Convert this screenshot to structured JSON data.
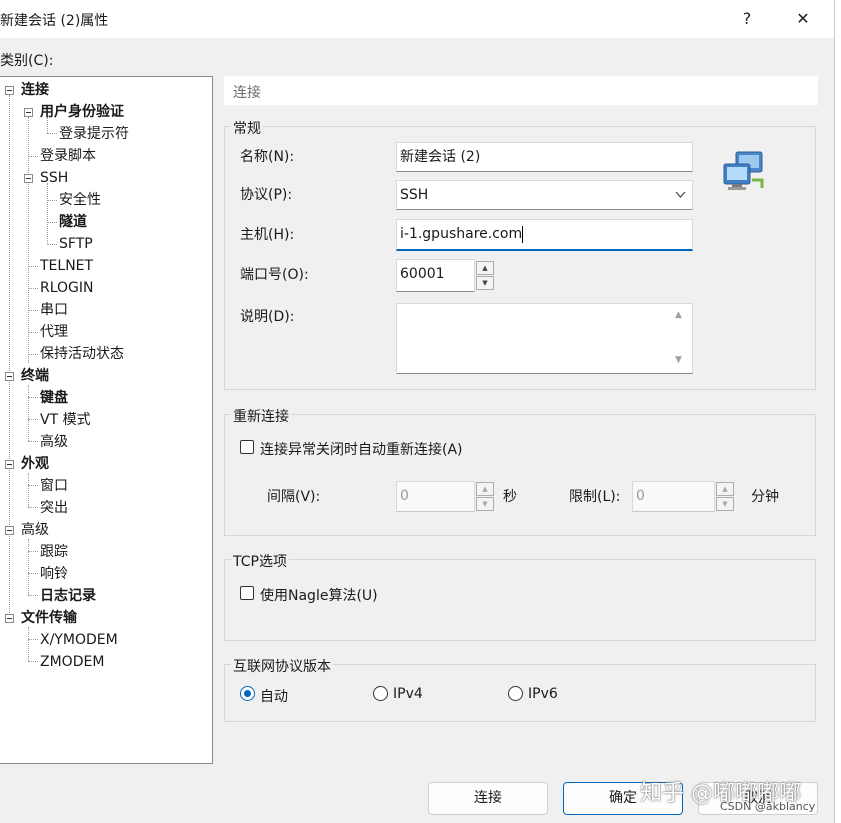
{
  "window": {
    "title": "新建会话 (2)属性",
    "help": "?",
    "close": "✕"
  },
  "category_label": "类别(C):",
  "tree": {
    "connection": "连接",
    "user_auth": "用户身份验证",
    "login_prompt": "登录提示符",
    "login_script": "登录脚本",
    "ssh": "SSH",
    "security": "安全性",
    "tunnel": "隧道",
    "sftp": "SFTP",
    "telnet": "TELNET",
    "rlogin": "RLOGIN",
    "serial": "串口",
    "proxy": "代理",
    "keepalive": "保持活动状态",
    "terminal": "终端",
    "keyboard": "键盘",
    "vt_mode": "VT 模式",
    "advanced1": "高级",
    "appearance": "外观",
    "window": "窗口",
    "highlight": "突出",
    "advanced2": "高级",
    "trace": "跟踪",
    "bell": "响铃",
    "logging": "日志记录",
    "file_transfer": "文件传输",
    "xymodem": "X/YMODEM",
    "zmodem": "ZMODEM"
  },
  "header": "连接",
  "general": {
    "title": "常规",
    "name_label": "名称(N):",
    "name_value": "新建会话 (2)",
    "protocol_label": "协议(P):",
    "protocol_value": "SSH",
    "host_label": "主机(H):",
    "host_value": "i-1.gpushare.com",
    "port_label": "端口号(O):",
    "port_value": "60001",
    "desc_label": "说明(D):",
    "desc_value": ""
  },
  "reconnect": {
    "title": "重新连接",
    "auto_label": "连接异常关闭时自动重新连接(A)",
    "interval_label": "间隔(V):",
    "interval_value": "0",
    "interval_unit": "秒",
    "limit_label": "限制(L):",
    "limit_value": "0",
    "limit_unit": "分钟"
  },
  "tcp": {
    "title": "TCP选项",
    "nagle_label": "使用Nagle算法(U)"
  },
  "ipver": {
    "title": "互联网协议版本",
    "auto": "自动",
    "ipv4": "IPv4",
    "ipv6": "IPv6"
  },
  "buttons": {
    "connect": "连接",
    "ok": "确定",
    "cancel": "取消"
  },
  "watermark": {
    "main": "知乎 @嘟嘟嘟嘟",
    "csdn": "CSDN @akblancy"
  },
  "colors": {
    "accent": "#0067c0"
  }
}
